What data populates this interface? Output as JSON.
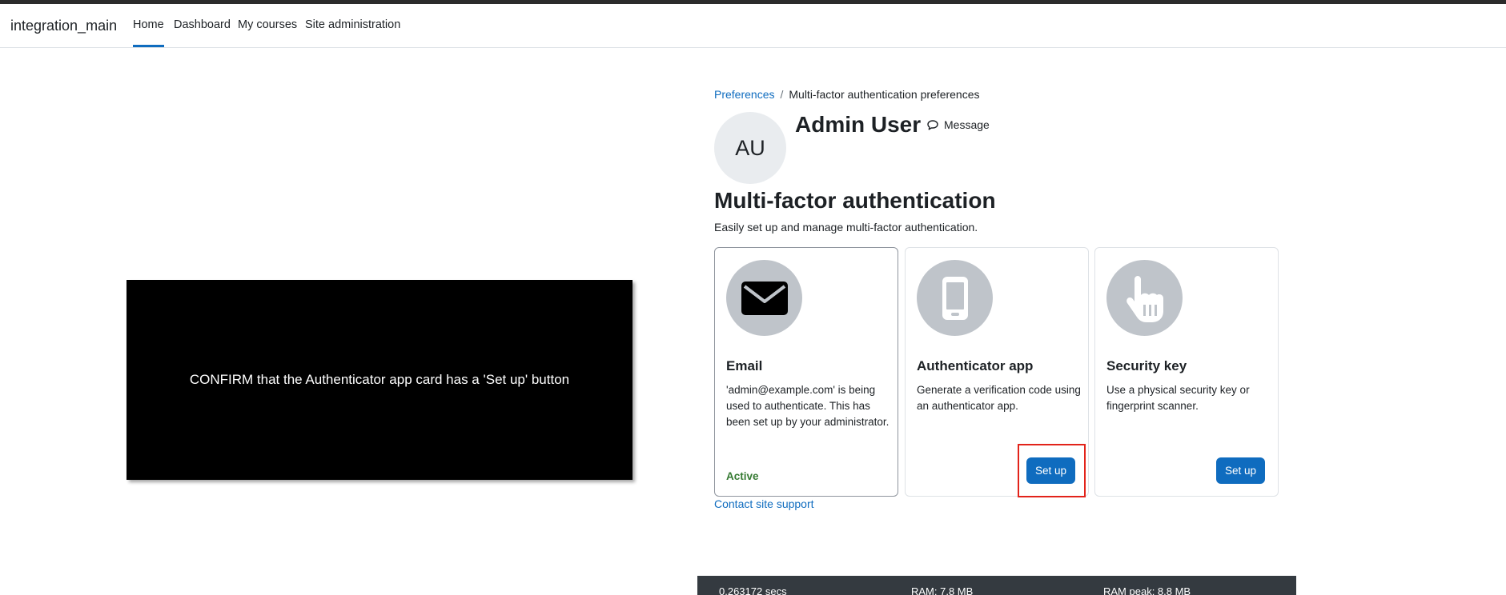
{
  "navbar": {
    "brand": "integration_main",
    "links": [
      "Home",
      "Dashboard",
      "My courses",
      "Site administration"
    ]
  },
  "overlay": {
    "text": "CONFIRM that the Authenticator app card has a 'Set up' button"
  },
  "breadcrumb": {
    "parent": "Preferences",
    "separator": "/",
    "current": "Multi-factor authentication preferences"
  },
  "profile": {
    "initials": "AU",
    "name": "Admin User",
    "message_label": "Message"
  },
  "page": {
    "title": "Multi-factor authentication",
    "description": "Easily set up and manage multi-factor authentication."
  },
  "cards": [
    {
      "icon": "envelope-icon",
      "title": "Email",
      "text": "'admin@example.com' is being used to authenticate. This has been set up by your administrator.",
      "status": "Active"
    },
    {
      "icon": "mobile-phone-icon",
      "title": "Authenticator app",
      "text": "Generate a verification code using an authenticator app.",
      "button": "Set up"
    },
    {
      "icon": "pointing-hand-icon",
      "title": "Security key",
      "text": "Use a physical security key or fingerprint scanner.",
      "button": "Set up"
    }
  ],
  "contact_link": "Contact site support",
  "footer": {
    "time": "0.263172 secs",
    "ram": "RAM: 7.8 MB",
    "ram_peak": "RAM peak: 8.8 MB"
  },
  "colors": {
    "primary": "#0f6cbf",
    "success": "#357a32",
    "highlight": "#e2231a",
    "icon_bg": "#bfc4ca"
  }
}
